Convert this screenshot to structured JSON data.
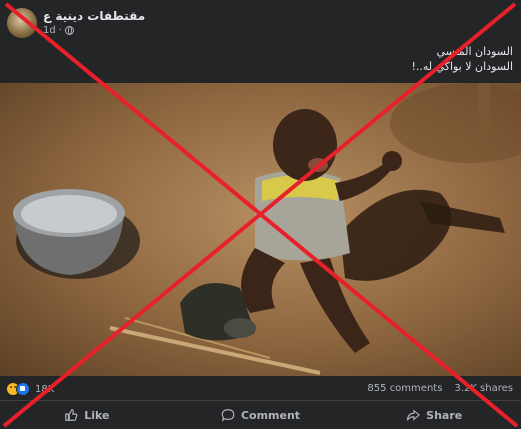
{
  "post": {
    "page_name": "مقتطفات دينية ع",
    "time": "1d",
    "caption_lines": [
      "السودان المنسي",
      "السودان لا بواكي له..!"
    ],
    "reaction_count": "18K",
    "comments": "855 comments",
    "shares": "3.2K shares"
  },
  "actions": {
    "like": "Like",
    "comment": "Comment",
    "share": "Share"
  },
  "icons": {
    "privacy": "globe-icon",
    "like": "thumbs-up-icon",
    "comment": "speech-bubble-icon",
    "share": "share-arrow-icon"
  },
  "overlay": {
    "mark": "red-x",
    "color": "#e8202a"
  }
}
